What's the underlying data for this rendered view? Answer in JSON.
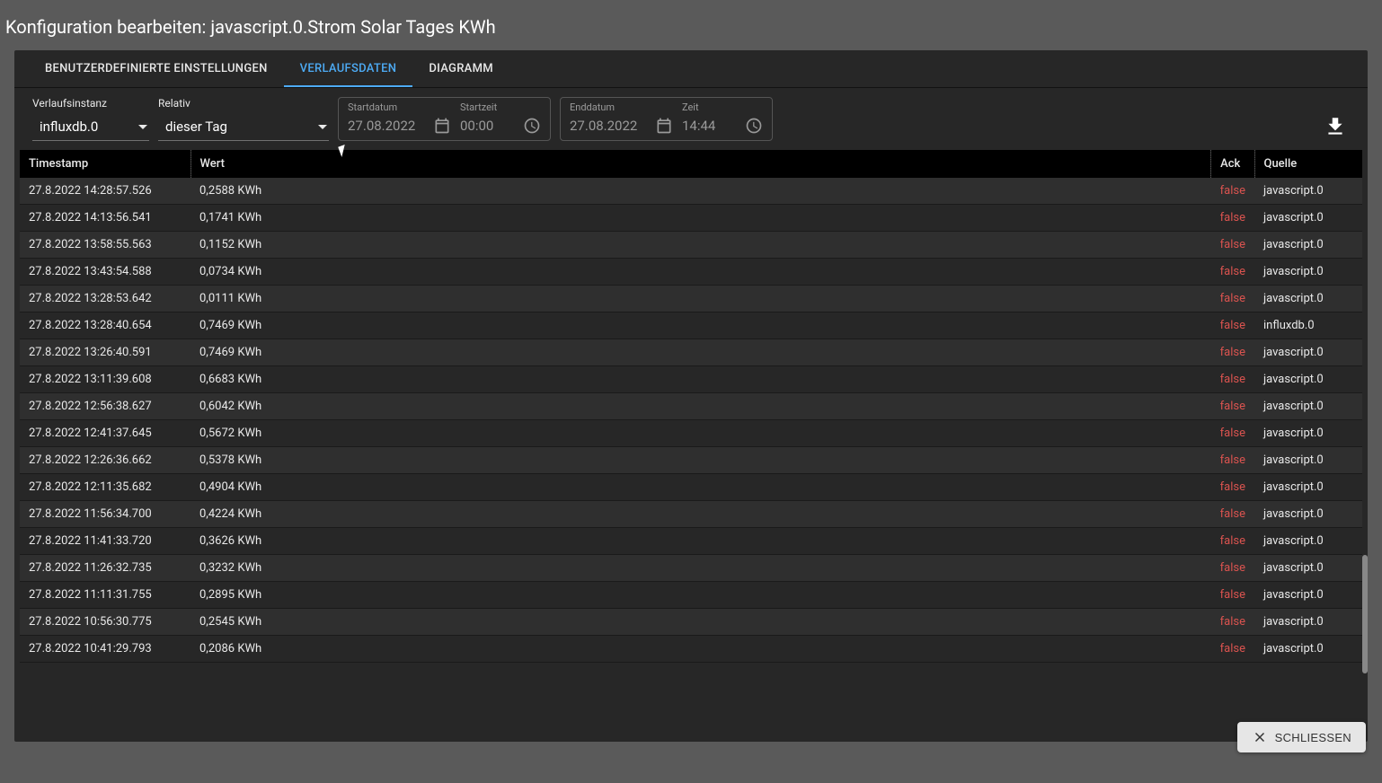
{
  "title": "Konfiguration bearbeiten: javascript.0.Strom Solar Tages KWh",
  "tabs": [
    {
      "label": "BENUTZERDEFINIERTE EINSTELLUNGEN",
      "active": false
    },
    {
      "label": "VERLAUFSDATEN",
      "active": true
    },
    {
      "label": "DIAGRAMM",
      "active": false
    }
  ],
  "filters": {
    "instance_label": "Verlaufsinstanz",
    "instance_value": "influxdb.0",
    "relative_label": "Relativ",
    "relative_value": "dieser Tag",
    "start_date_label": "Startdatum",
    "start_date_value": "27.08.2022",
    "start_time_label": "Startzeit",
    "start_time_value": "00:00",
    "end_date_label": "Enddatum",
    "end_date_value": "27.08.2022",
    "end_time_label": "Zeit",
    "end_time_value": "14:44"
  },
  "table": {
    "headers": {
      "ts": "Timestamp",
      "val": "Wert",
      "ack": "Ack",
      "src": "Quelle"
    },
    "rows": [
      {
        "ts": "27.8.2022 14:28:57.526",
        "val": "0,2588 KWh",
        "ack": "false",
        "src": "javascript.0"
      },
      {
        "ts": "27.8.2022 14:13:56.541",
        "val": "0,1741 KWh",
        "ack": "false",
        "src": "javascript.0"
      },
      {
        "ts": "27.8.2022 13:58:55.563",
        "val": "0,1152 KWh",
        "ack": "false",
        "src": "javascript.0"
      },
      {
        "ts": "27.8.2022 13:43:54.588",
        "val": "0,0734 KWh",
        "ack": "false",
        "src": "javascript.0"
      },
      {
        "ts": "27.8.2022 13:28:53.642",
        "val": "0,0111 KWh",
        "ack": "false",
        "src": "javascript.0"
      },
      {
        "ts": "27.8.2022 13:28:40.654",
        "val": "0,7469 KWh",
        "ack": "false",
        "src": "influxdb.0"
      },
      {
        "ts": "27.8.2022 13:26:40.591",
        "val": "0,7469 KWh",
        "ack": "false",
        "src": "javascript.0"
      },
      {
        "ts": "27.8.2022 13:11:39.608",
        "val": "0,6683 KWh",
        "ack": "false",
        "src": "javascript.0"
      },
      {
        "ts": "27.8.2022 12:56:38.627",
        "val": "0,6042 KWh",
        "ack": "false",
        "src": "javascript.0"
      },
      {
        "ts": "27.8.2022 12:41:37.645",
        "val": "0,5672 KWh",
        "ack": "false",
        "src": "javascript.0"
      },
      {
        "ts": "27.8.2022 12:26:36.662",
        "val": "0,5378 KWh",
        "ack": "false",
        "src": "javascript.0"
      },
      {
        "ts": "27.8.2022 12:11:35.682",
        "val": "0,4904 KWh",
        "ack": "false",
        "src": "javascript.0"
      },
      {
        "ts": "27.8.2022 11:56:34.700",
        "val": "0,4224 KWh",
        "ack": "false",
        "src": "javascript.0"
      },
      {
        "ts": "27.8.2022 11:41:33.720",
        "val": "0,3626 KWh",
        "ack": "false",
        "src": "javascript.0"
      },
      {
        "ts": "27.8.2022 11:26:32.735",
        "val": "0,3232 KWh",
        "ack": "false",
        "src": "javascript.0"
      },
      {
        "ts": "27.8.2022 11:11:31.755",
        "val": "0,2895 KWh",
        "ack": "false",
        "src": "javascript.0"
      },
      {
        "ts": "27.8.2022 10:56:30.775",
        "val": "0,2545 KWh",
        "ack": "false",
        "src": "javascript.0"
      },
      {
        "ts": "27.8.2022 10:41:29.793",
        "val": "0,2086 KWh",
        "ack": "false",
        "src": "javascript.0"
      }
    ]
  },
  "buttons": {
    "close": "SCHLIESSEN"
  }
}
